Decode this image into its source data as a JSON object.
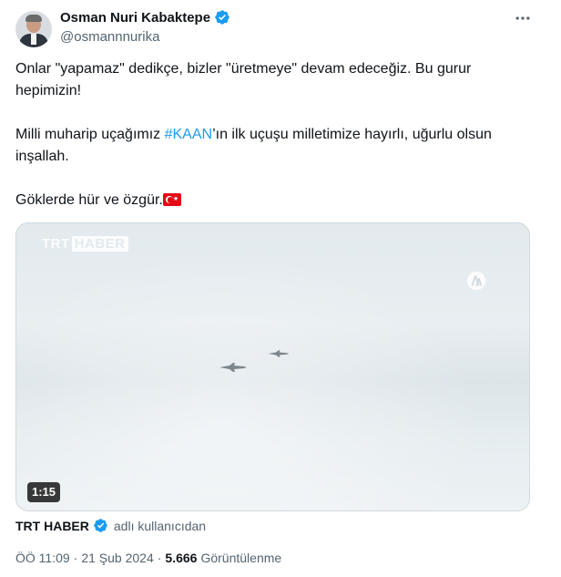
{
  "author": {
    "display_name": "Osman Nuri Kabaktepe",
    "handle": "@osmannnurika"
  },
  "tweet": {
    "para1": "Onlar \"yapamaz\" dedikçe, bizler \"üretmeye\" devam edeceğiz. Bu gurur hepimizin!",
    "para2_before": "Milli muharip uçağımız ",
    "hashtag": "#KAAN",
    "para2_after": "’ın ilk uçuşu milletimize hayırlı, uğurlu olsun inşallah.",
    "para3": "Göklerde hür ve özgür."
  },
  "media": {
    "watermark_trt": "TRT",
    "watermark_haber": "HABER",
    "duration": "1:15"
  },
  "source": {
    "name": "TRT HABER",
    "suffix": "adlı kullanıcıdan"
  },
  "meta": {
    "time": "ÖÖ 11:09",
    "separator": "·",
    "date": "21 Şub 2024",
    "views_count": "5.666",
    "views_label": "Görüntülenme"
  },
  "icons": {
    "verified": "verified-badge-icon",
    "more": "more-horizontal-icon",
    "flag": "turkey-flag-emoji"
  },
  "colors": {
    "accent": "#1d9bf0",
    "secondary_text": "#536471",
    "primary_text": "#0f1419"
  }
}
